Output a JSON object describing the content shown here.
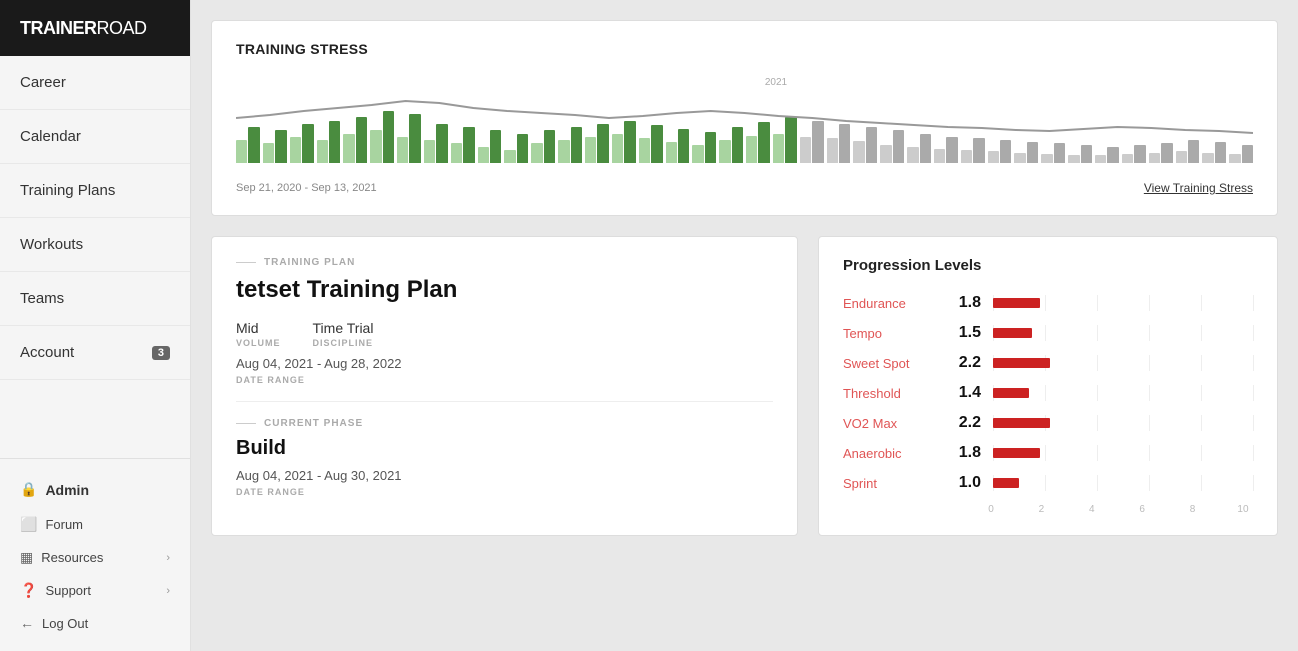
{
  "sidebar": {
    "logo": "TRAINERROAD",
    "nav_items": [
      {
        "id": "career",
        "label": "Career"
      },
      {
        "id": "calendar",
        "label": "Calendar"
      },
      {
        "id": "training-plans",
        "label": "Training Plans"
      },
      {
        "id": "workouts",
        "label": "Workouts"
      },
      {
        "id": "teams",
        "label": "Teams"
      },
      {
        "id": "account",
        "label": "Account",
        "badge": "3"
      }
    ],
    "admin_label": "Admin",
    "bottom_items": [
      {
        "id": "forum",
        "label": "Forum",
        "icon": "⬜"
      },
      {
        "id": "resources",
        "label": "Resources",
        "icon": "▦",
        "has_chevron": true
      },
      {
        "id": "support",
        "label": "Support",
        "icon": "❓",
        "has_chevron": true
      }
    ],
    "logout_label": "Log Out"
  },
  "training_stress": {
    "title": "Training Stress",
    "date_range": "Sep 21, 2020 - Sep 13, 2021",
    "view_link": "View Training Stress",
    "year_label": "2021",
    "bars": [
      {
        "dark": 55,
        "light": 35
      },
      {
        "dark": 50,
        "light": 30
      },
      {
        "dark": 60,
        "light": 40
      },
      {
        "dark": 65,
        "light": 35
      },
      {
        "dark": 70,
        "light": 45
      },
      {
        "dark": 80,
        "light": 50
      },
      {
        "dark": 75,
        "light": 40
      },
      {
        "dark": 60,
        "light": 35
      },
      {
        "dark": 55,
        "light": 30
      },
      {
        "dark": 50,
        "light": 25
      },
      {
        "dark": 45,
        "light": 20
      },
      {
        "dark": 50,
        "light": 30
      },
      {
        "dark": 55,
        "light": 35
      },
      {
        "dark": 60,
        "light": 40
      },
      {
        "dark": 65,
        "light": 45
      },
      {
        "dark": 58,
        "light": 38
      },
      {
        "dark": 52,
        "light": 32
      },
      {
        "dark": 48,
        "light": 28
      },
      {
        "dark": 55,
        "light": 35
      },
      {
        "dark": 62,
        "light": 42
      },
      {
        "dark": 70,
        "light": 45
      },
      {
        "dark": 65,
        "light": 40
      },
      {
        "dark": 60,
        "light": 38
      },
      {
        "dark": 55,
        "light": 33
      },
      {
        "dark": 50,
        "light": 28
      },
      {
        "dark": 45,
        "light": 25
      },
      {
        "dark": 40,
        "light": 22
      },
      {
        "dark": 38,
        "light": 20
      },
      {
        "dark": 35,
        "light": 18
      },
      {
        "dark": 32,
        "light": 16
      },
      {
        "dark": 30,
        "light": 14
      },
      {
        "dark": 28,
        "light": 13
      },
      {
        "dark": 25,
        "light": 12
      },
      {
        "dark": 28,
        "light": 14
      },
      {
        "dark": 30,
        "light": 15
      },
      {
        "dark": 35,
        "light": 18
      },
      {
        "dark": 32,
        "light": 16
      },
      {
        "dark": 28,
        "light": 14
      }
    ]
  },
  "training_plan": {
    "section_label": "TRAINING PLAN",
    "plan_name": "tetset Training Plan",
    "volume_label": "VOLUME",
    "volume_value": "Mid",
    "discipline_label": "DISCIPLINE",
    "discipline_value": "Time Trial",
    "date_range_label": "DATE RANGE",
    "date_range_value": "Aug 04, 2021 - Aug 28, 2022",
    "current_phase_label": "CURRENT PHASE",
    "phase_name": "Build",
    "phase_date_range_label": "DATE RANGE",
    "phase_date_range": "Aug 04, 2021 - Aug 30, 2021"
  },
  "progression_levels": {
    "title": "Progression Levels",
    "items": [
      {
        "label": "Endurance",
        "value": "1.8",
        "numeric": 1.8
      },
      {
        "label": "Tempo",
        "value": "1.5",
        "numeric": 1.5
      },
      {
        "label": "Sweet Spot",
        "value": "2.2",
        "numeric": 2.2
      },
      {
        "label": "Threshold",
        "value": "1.4",
        "numeric": 1.4
      },
      {
        "label": "VO2 Max",
        "value": "2.2",
        "numeric": 2.2
      },
      {
        "label": "Anaerobic",
        "value": "1.8",
        "numeric": 1.8
      },
      {
        "label": "Sprint",
        "value": "1.0",
        "numeric": 1.0
      }
    ],
    "axis_labels": [
      "0",
      "2",
      "4",
      "6",
      "8",
      "10"
    ],
    "max_value": 10
  }
}
